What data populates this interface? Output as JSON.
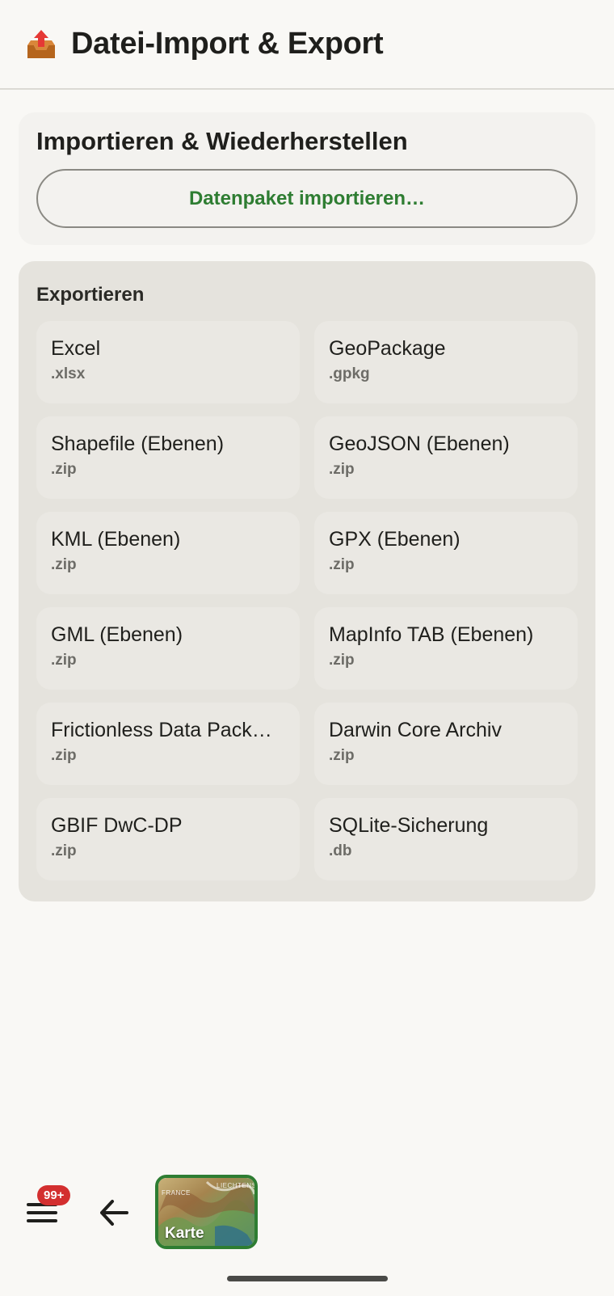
{
  "header": {
    "icon": "outbox-tray-icon",
    "title": "Datei-Import & Export"
  },
  "import_section": {
    "title": "Importieren & Wiederherstellen",
    "button_label": "Datenpaket importieren…",
    "accent_color": "#2e7d32"
  },
  "export_section": {
    "title": "Exportieren",
    "items": [
      {
        "label": "Excel",
        "ext": ".xlsx"
      },
      {
        "label": "GeoPackage",
        "ext": ".gpkg"
      },
      {
        "label": "Shapefile (Ebenen)",
        "ext": ".zip"
      },
      {
        "label": "GeoJSON (Ebenen)",
        "ext": ".zip"
      },
      {
        "label": "KML (Ebenen)",
        "ext": ".zip"
      },
      {
        "label": "GPX (Ebenen)",
        "ext": ".zip"
      },
      {
        "label": "GML (Ebenen)",
        "ext": ".zip"
      },
      {
        "label": "MapInfo TAB (Ebenen)",
        "ext": ".zip"
      },
      {
        "label": "Frictionless Data Pack…",
        "ext": ".zip"
      },
      {
        "label": "Darwin Core Archiv",
        "ext": ".zip"
      },
      {
        "label": "GBIF DwC-DP",
        "ext": ".zip"
      },
      {
        "label": "SQLite-Sicherung",
        "ext": ".db"
      }
    ]
  },
  "bottom_bar": {
    "menu_icon": "hamburger-menu-icon",
    "badge": "99+",
    "back_icon": "arrow-left-icon",
    "map_label": "Karte",
    "map_place_1": "FRANCE",
    "map_place_2": "LIECHTENS"
  },
  "colors": {
    "badge": "#d32f2f",
    "map_border": "#2e7d32"
  }
}
